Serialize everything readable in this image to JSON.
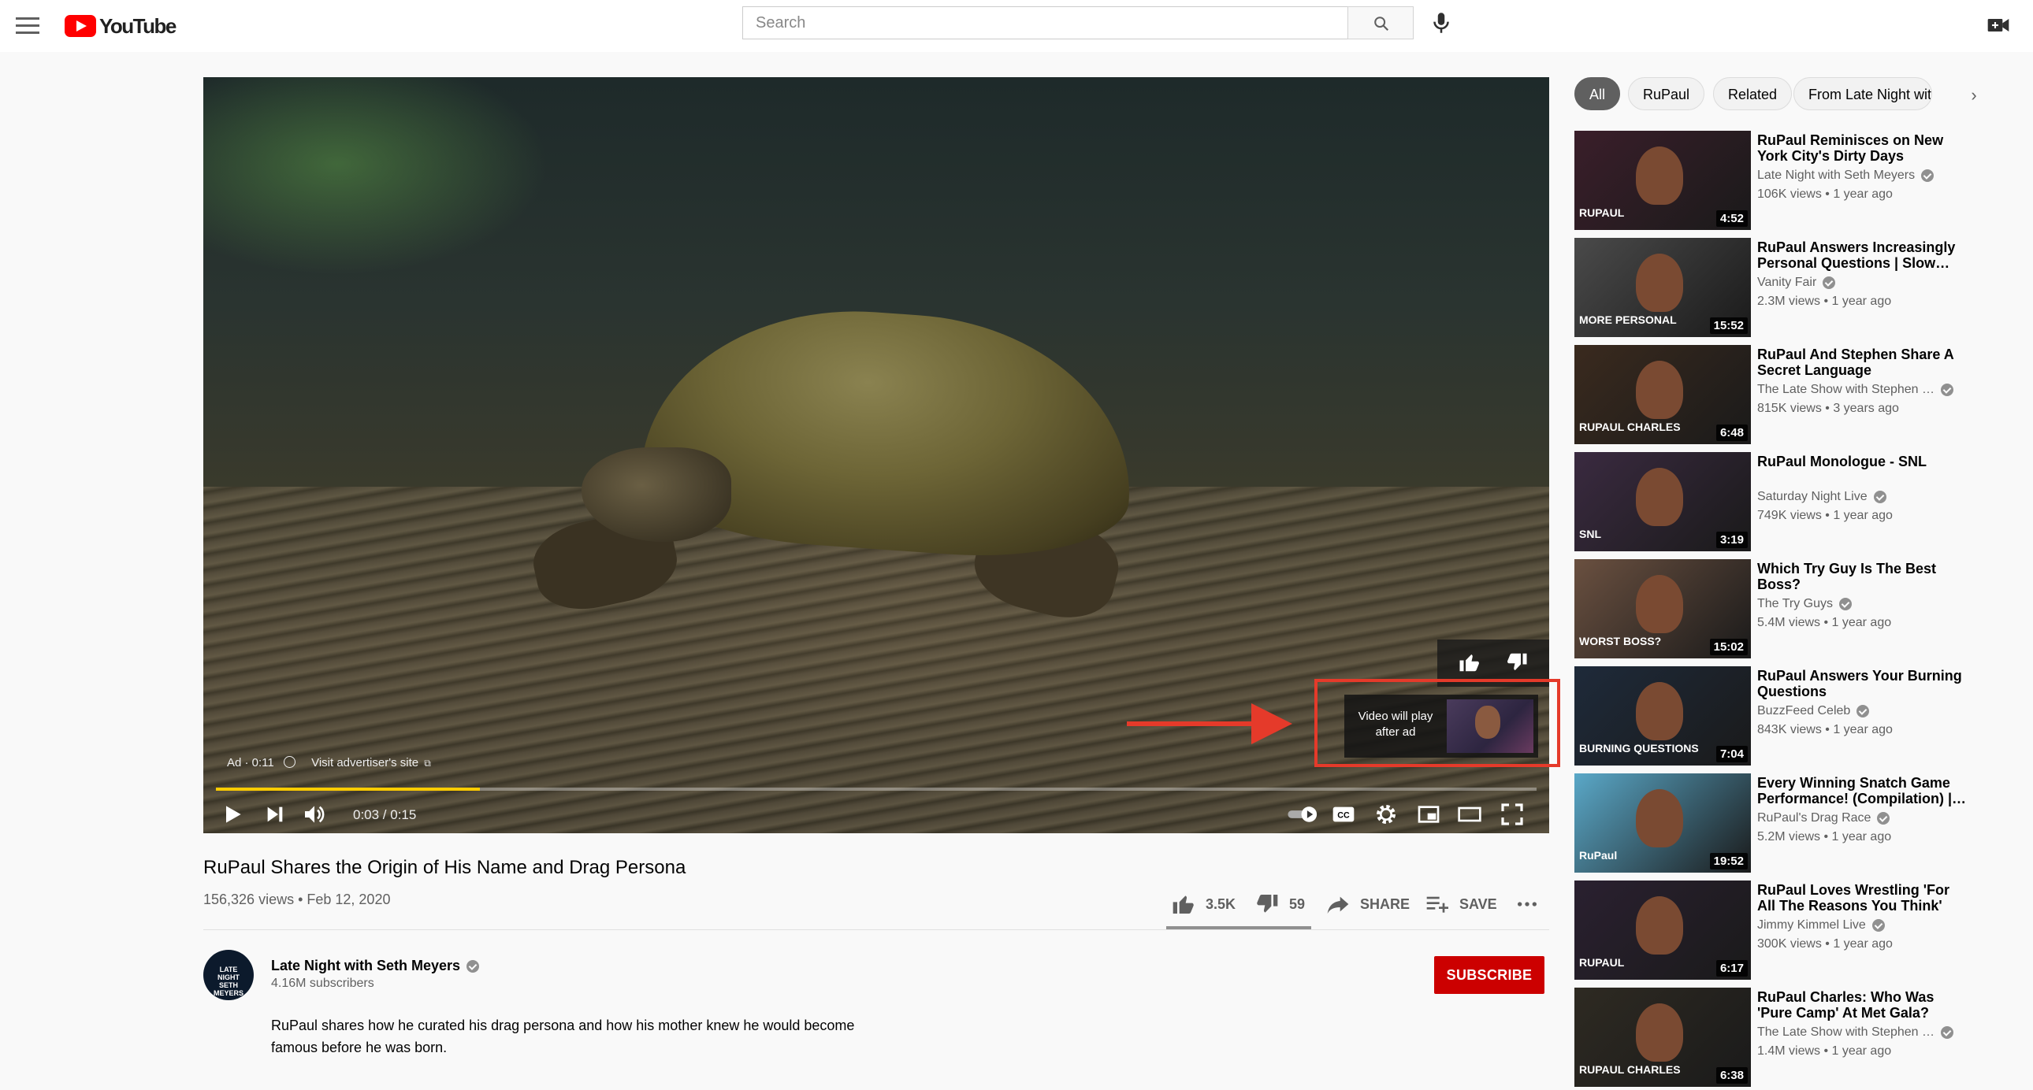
{
  "masthead": {
    "logo_text": "YouTube",
    "search_placeholder": "Search"
  },
  "player": {
    "ad_label": "Ad · 0:11",
    "ad_link": "Visit advertiser's site",
    "time": "0:03 / 0:15",
    "progress_fraction": 0.2,
    "after_ad_text": "Video will play after ad"
  },
  "video": {
    "title": "RuPaul Shares the Origin of His Name and Drag Persona",
    "meta": "156,326 views • Feb 12, 2020",
    "likes": "3.5K",
    "dislikes": "59",
    "share_label": "SHARE",
    "save_label": "SAVE"
  },
  "channel": {
    "avatar_text": "LATE NIGHT SETH MEYERS",
    "name": "Late Night with Seth Meyers",
    "subscribers": "4.16M subscribers",
    "subscribe_label": "SUBSCRIBE",
    "description": "RuPaul shares how he curated his drag persona and how his mother knew he would become famous before he was born."
  },
  "chips": [
    "All",
    "RuPaul",
    "Related",
    "From Late Night wit"
  ],
  "recommendations": [
    {
      "title": "RuPaul Reminisces on New York City's Dirty Days",
      "channel": "Late Night with Seth Meyers",
      "meta": "106K views • 1 year ago",
      "duration": "4:52",
      "thumb_label": "RUPAUL",
      "bg": "#3a1e2a"
    },
    {
      "title": "RuPaul Answers Increasingly Personal Questions | Slow…",
      "channel": "Vanity Fair",
      "meta": "2.3M views • 1 year ago",
      "duration": "15:52",
      "thumb_label": "MORE PERSONAL",
      "bg": "#4a4a4a"
    },
    {
      "title": "RuPaul And Stephen Share A Secret Language",
      "channel": "The Late Show with Stephen …",
      "meta": "815K views • 3 years ago",
      "duration": "6:48",
      "thumb_label": "RUPAUL CHARLES",
      "bg": "#3a2a1e"
    },
    {
      "title": "RuPaul Monologue - SNL",
      "channel": "Saturday Night Live",
      "meta": "749K views • 1 year ago",
      "duration": "3:19",
      "thumb_label": "SNL",
      "bg": "#3a2a40"
    },
    {
      "title": "Which Try Guy Is The Best Boss?",
      "channel": "The Try Guys",
      "meta": "5.4M views • 1 year ago",
      "duration": "15:02",
      "thumb_label": "WORST BOSS?",
      "bg": "#6a5040"
    },
    {
      "title": "RuPaul Answers Your Burning Questions",
      "channel": "BuzzFeed Celeb",
      "meta": "843K views • 1 year ago",
      "duration": "7:04",
      "thumb_label": "BURNING QUESTIONS",
      "bg": "#1e2a3a"
    },
    {
      "title": "Every Winning Snatch Game Performance! (Compilation) |…",
      "channel": "RuPaul's Drag Race",
      "meta": "5.2M views • 1 year ago",
      "duration": "19:52",
      "thumb_label": "RuPaul",
      "bg": "#5aa8c8"
    },
    {
      "title": "RuPaul Loves Wrestling 'For All The Reasons You Think'",
      "channel": "Jimmy Kimmel Live",
      "meta": "300K views • 1 year ago",
      "duration": "6:17",
      "thumb_label": "RUPAUL",
      "bg": "#2a2030"
    },
    {
      "title": "RuPaul Charles: Who Was 'Pure Camp' At Met Gala?",
      "channel": "The Late Show with Stephen …",
      "meta": "1.4M views • 1 year ago",
      "duration": "6:38",
      "thumb_label": "RUPAUL CHARLES",
      "bg": "#2e2a22"
    }
  ],
  "colors": {
    "brand_red": "#ff0000",
    "subscribe_red": "#cc0000",
    "ad_progress": "#ffcc00",
    "annotation_red": "#e53a2a"
  }
}
